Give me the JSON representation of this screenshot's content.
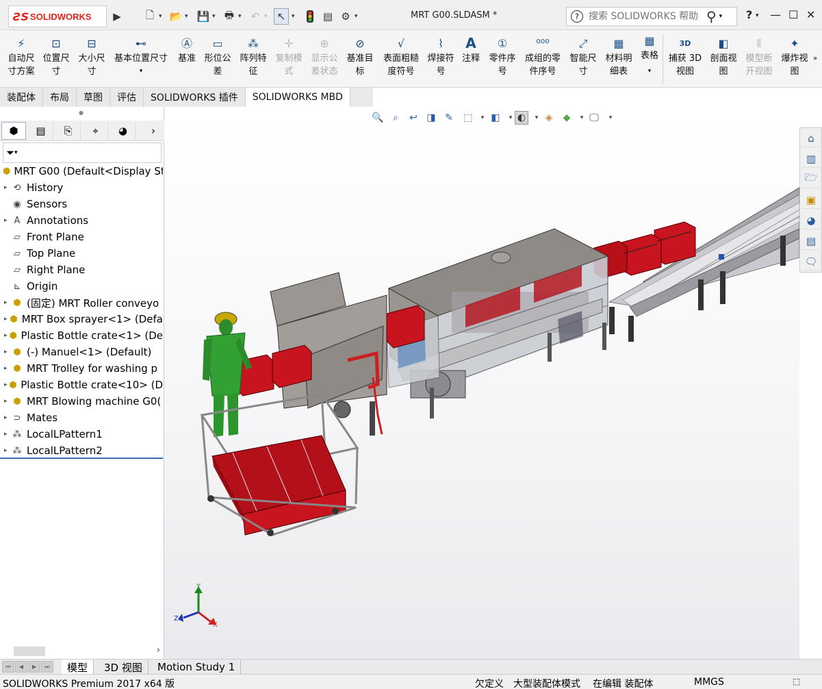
{
  "app": {
    "logo_ds": "ƧS",
    "logo_name": "SOLIDWORKS",
    "doc_title": "MRT G00.SLDASM *",
    "search_placeholder": "搜索 SOLIDWORKS 帮助",
    "help_label": "?"
  },
  "ribbon": {
    "items": [
      {
        "label_1": "自动尺",
        "label_2": "寸方案",
        "icon": "smart-dim-scheme-icon"
      },
      {
        "label_1": "位置尺",
        "label_2": "寸",
        "icon": "location-dim-icon"
      },
      {
        "label_1": "大小尺",
        "label_2": "寸",
        "icon": "size-dim-icon"
      },
      {
        "label_1": "基本位置尺寸",
        "label_2": "",
        "icon": "basic-location-dim-icon"
      },
      {
        "label_1": "基准",
        "label_2": "",
        "icon": "datum-icon"
      },
      {
        "label_1": "形位公",
        "label_2": "差",
        "icon": "geometric-tolerance-icon"
      },
      {
        "label_1": "阵列特",
        "label_2": "征",
        "icon": "pattern-feature-icon"
      },
      {
        "label_1": "复制模",
        "label_2": "式",
        "icon": "copy-scheme-icon"
      },
      {
        "label_1": "显示公",
        "label_2": "差状态",
        "icon": "show-tolerance-status-icon"
      },
      {
        "label_1": "基准目",
        "label_2": "标",
        "icon": "datum-target-icon"
      },
      {
        "label_1": "表面粗糙",
        "label_2": "度符号",
        "icon": "surface-finish-icon"
      },
      {
        "label_1": "焊接符",
        "label_2": "号",
        "icon": "weld-symbol-icon"
      },
      {
        "label_1": "注释",
        "label_2": "",
        "icon": "note-icon"
      },
      {
        "label_1": "零件序",
        "label_2": "号",
        "icon": "balloon-icon"
      },
      {
        "label_1": "成组的零",
        "label_2": "件序号",
        "icon": "stacked-balloon-icon"
      },
      {
        "label_1": "智能尺",
        "label_2": "寸",
        "icon": "smart-dimension-icon"
      },
      {
        "label_1": "材料明",
        "label_2": "细表",
        "icon": "bom-icon"
      },
      {
        "label_1": "表格",
        "label_2": "",
        "icon": "table-icon"
      },
      {
        "label_1": "捕获 3D",
        "label_2": "视图",
        "icon": "capture-3d-view-icon"
      },
      {
        "label_1": "剖面视",
        "label_2": "图",
        "icon": "section-view-icon"
      },
      {
        "label_1": "模型断",
        "label_2": "开视图",
        "icon": "model-break-view-icon"
      },
      {
        "label_1": "爆炸视",
        "label_2": "图",
        "icon": "exploded-view-icon"
      }
    ]
  },
  "tabs": [
    "装配体",
    "布局",
    "草图",
    "评估",
    "SOLIDWORKS 插件",
    "SOLIDWORKS MBD"
  ],
  "tree": {
    "root": "MRT G00  (Default<Display St",
    "items": [
      {
        "label": "History",
        "icon": "history-icon",
        "expand": true
      },
      {
        "label": "Sensors",
        "icon": "sensors-icon",
        "expand": false
      },
      {
        "label": "Annotations",
        "icon": "annotations-icon",
        "expand": true
      },
      {
        "label": "Front Plane",
        "icon": "plane-icon",
        "expand": false
      },
      {
        "label": "Top Plane",
        "icon": "plane-icon",
        "expand": false
      },
      {
        "label": "Right Plane",
        "icon": "plane-icon",
        "expand": false
      },
      {
        "label": "Origin",
        "icon": "origin-icon",
        "expand": false
      },
      {
        "label": "(固定) MRT Roller conveyo",
        "icon": "subassembly-icon",
        "expand": true
      },
      {
        "label": "MRT Box sprayer<1> (Defa",
        "icon": "subassembly-icon",
        "expand": true
      },
      {
        "label": "Plastic Bottle crate<1> (De",
        "icon": "subassembly-icon",
        "expand": true
      },
      {
        "label": "(-) Manuel<1> (Default)",
        "icon": "subassembly-icon",
        "expand": true
      },
      {
        "label": "MRT Trolley for washing p",
        "icon": "subassembly-icon",
        "expand": true
      },
      {
        "label": "Plastic Bottle crate<10> (D",
        "icon": "subassembly-icon",
        "expand": true
      },
      {
        "label": "MRT Blowing machine G0(",
        "icon": "subassembly-icon",
        "expand": true
      },
      {
        "label": "Mates",
        "icon": "mates-icon",
        "expand": true
      },
      {
        "label": "LocalLPattern1",
        "icon": "pattern-icon",
        "expand": true
      },
      {
        "label": "LocalLPattern2",
        "icon": "pattern-icon",
        "expand": true
      }
    ]
  },
  "triad": {
    "x": "X",
    "y": "Y",
    "z": "Z"
  },
  "bottom_tabs": [
    "模型",
    "3D 视图",
    "Motion Study 1"
  ],
  "status": {
    "product": "SOLIDWORKS Premium 2017 x64 版",
    "defined": "欠定义",
    "mode": "大型装配体模式",
    "editing": "在编辑 装配体",
    "units": "MMGS"
  }
}
